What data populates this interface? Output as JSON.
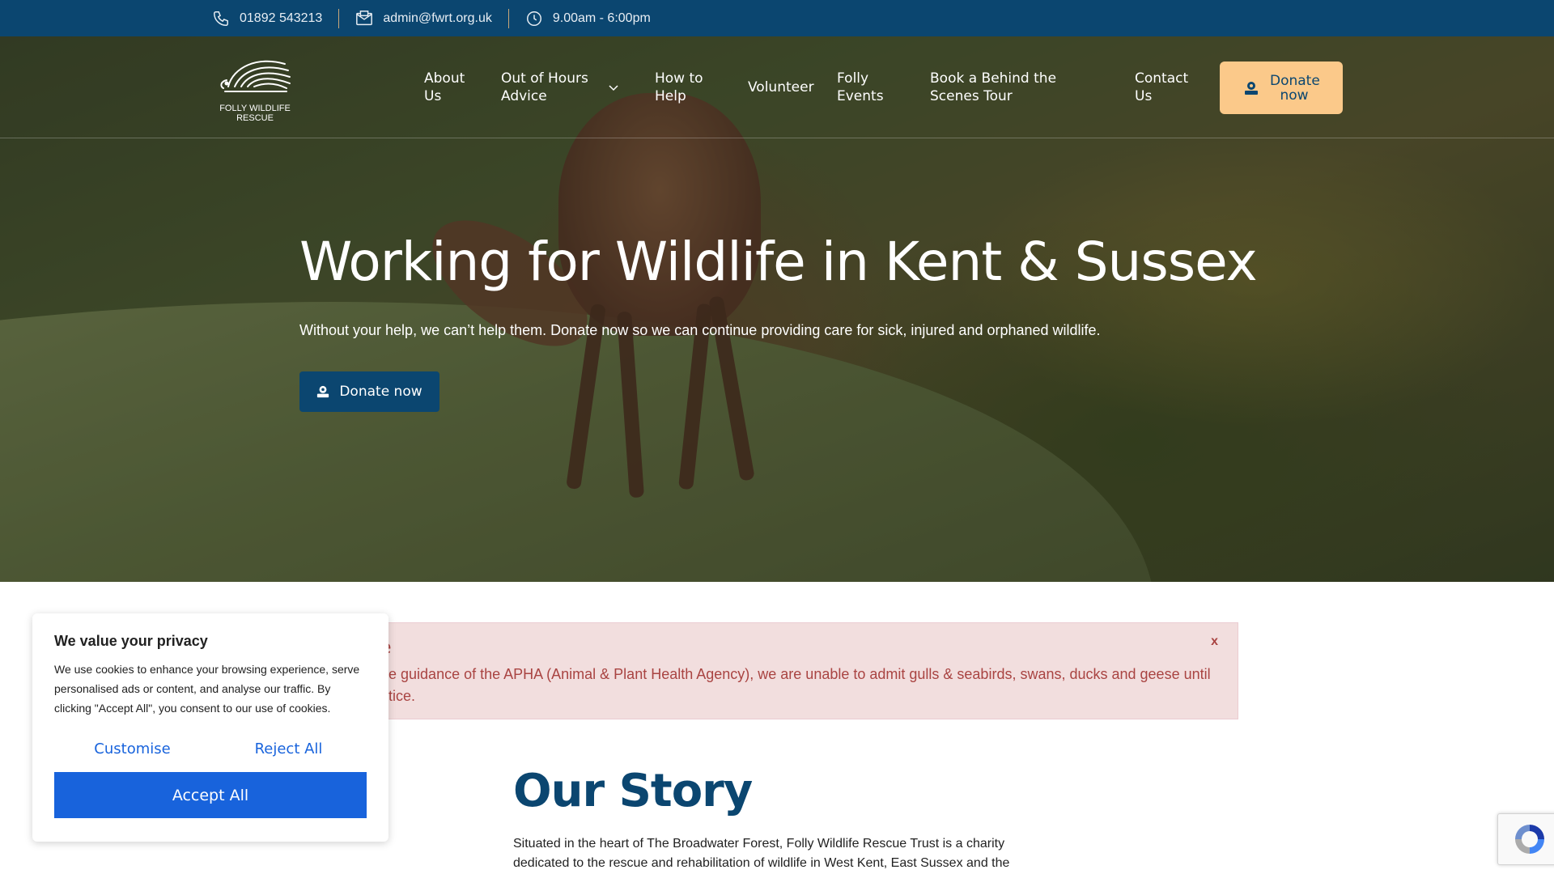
{
  "topbar": {
    "phone": "01892 543213",
    "email": "admin@fwrt.org.uk",
    "hours": "9.00am - 6:00pm"
  },
  "logo": {
    "line1": "FOLLY WILDLIFE",
    "line2": "RESCUE"
  },
  "nav": {
    "items": [
      "About Us",
      "Out of Hours Advice",
      "How to Help",
      "Volunteer",
      "Folly Events",
      "Book a Behind the Scenes Tour",
      "Contact Us"
    ],
    "donate_label": "Donate now"
  },
  "hero": {
    "title": "Working for Wildlife in Kent & Sussex",
    "subtitle": "Without your help, we can’t help them. Donate now so we can continue providing care for sick, injured and orphaned wildlife.",
    "donate_label": "Donate now"
  },
  "notice": {
    "title_visible": "e",
    "text_line1": "he guidance of the APHA (Animal & Plant Health Agency), we are unable to admit gulls & seabirds, swans, ducks and geese until",
    "text_line2": "otice.",
    "close": "x"
  },
  "story": {
    "title": "Our Story",
    "text": "Situated in the heart of The Broadwater Forest, Folly Wildlife Rescue Trust is a charity dedicated to the rescue and rehabilitation of wildlife in West Kent, East Sussex and the"
  },
  "cookie": {
    "title": "We value your privacy",
    "text": "We use cookies to enhance your browsing experience, serve personalised ads or content, and analyse our traffic. By clicking \"Accept All\", you consent to our use of cookies.",
    "customise": "Customise",
    "reject": "Reject All",
    "accept": "Accept All"
  },
  "colors": {
    "brand_blue": "#0b4670",
    "donate_orange": "#fbc98a",
    "cookie_blue": "#1863dc",
    "notice_bg": "#f2dede",
    "notice_text": "#a94442"
  },
  "icons": [
    "phone-icon",
    "mail-icon",
    "clock-icon",
    "chevron-down-icon",
    "donate-icon",
    "recaptcha-icon",
    "hedgehog-logo-icon"
  ]
}
